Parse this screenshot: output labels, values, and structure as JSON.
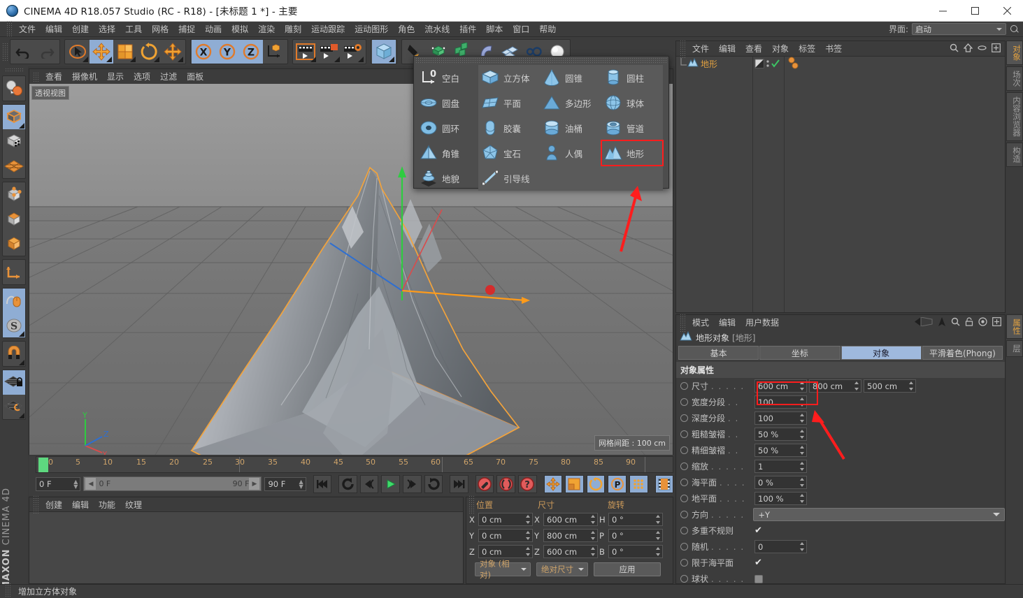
{
  "window": {
    "title": "CINEMA 4D R18.057 Studio (RC - R18) - [未标题 1 *] - 主要",
    "minimize": "—",
    "maximize": "▢",
    "close": "✕"
  },
  "menubar": {
    "items": [
      "文件",
      "编辑",
      "创建",
      "选择",
      "工具",
      "网格",
      "捕捉",
      "动画",
      "模拟",
      "渲染",
      "雕刻",
      "运动跟踪",
      "运动图形",
      "角色",
      "流水线",
      "插件",
      "脚本",
      "窗口",
      "帮助"
    ],
    "interface_label": "界面:",
    "interface_value": "启动"
  },
  "viewport": {
    "menu": [
      "查看",
      "摄像机",
      "显示",
      "选项",
      "过滤",
      "面板"
    ],
    "view_label": "透视视图",
    "grid_info": "网格间距 : 100 cm",
    "axis": {
      "y": "Y",
      "x": "X",
      "z": "Z"
    }
  },
  "primitives_popup": {
    "columns": [
      {
        "shaded": false,
        "items": [
          {
            "label": "空白",
            "icon": "null-object-icon"
          },
          {
            "label": "圆盘",
            "icon": "disc-icon"
          },
          {
            "label": "圆环",
            "icon": "torus-icon"
          },
          {
            "label": "角锥",
            "icon": "pyramid-icon"
          },
          {
            "label": "地貌",
            "icon": "landscape-icon"
          }
        ]
      },
      {
        "shaded": true,
        "items": [
          {
            "label": "立方体",
            "icon": "cube-icon"
          },
          {
            "label": "平面",
            "icon": "plane-icon"
          },
          {
            "label": "胶囊",
            "icon": "capsule-icon"
          },
          {
            "label": "宝石",
            "icon": "platonic-icon"
          },
          {
            "label": "引导线",
            "icon": "guide-line-icon"
          }
        ]
      },
      {
        "shaded": true,
        "items": [
          {
            "label": "圆锥",
            "icon": "cone-icon"
          },
          {
            "label": "多边形",
            "icon": "polygon-icon"
          },
          {
            "label": "油桶",
            "icon": "oil-tank-icon"
          },
          {
            "label": "人偶",
            "icon": "figure-icon"
          }
        ]
      },
      {
        "shaded": true,
        "items": [
          {
            "label": "圆柱",
            "icon": "cylinder-icon"
          },
          {
            "label": "球体",
            "icon": "sphere-icon"
          },
          {
            "label": "管道",
            "icon": "tube-icon"
          },
          {
            "label": "地形",
            "icon": "terrain-icon",
            "highlight": true
          }
        ]
      }
    ]
  },
  "timeline": {
    "ticks": [
      "0",
      "5",
      "10",
      "15",
      "20",
      "25",
      "30",
      "35",
      "40",
      "45",
      "50",
      "55",
      "60",
      "65",
      "70",
      "75",
      "80",
      "85",
      "90"
    ],
    "current_frame": "0 F",
    "range_start": "0 F",
    "range_end": "90 F",
    "end_frame": "90 F",
    "preview_frame": "0 F",
    "buttons": [
      {
        "name": "go-to-start-button",
        "glyph": "◀◀"
      },
      {
        "name": "rewind-button",
        "glyph": "↺"
      },
      {
        "name": "step-back-button",
        "glyph": "◁("
      },
      {
        "name": "play-button",
        "glyph": "▶"
      },
      {
        "name": "step-forward-button",
        "glyph": ")▷"
      },
      {
        "name": "loop-button",
        "glyph": "↻"
      },
      {
        "name": "go-to-end-button",
        "glyph": "▶▶|"
      }
    ]
  },
  "materials": {
    "menu": [
      "创建",
      "编辑",
      "功能",
      "纹理"
    ]
  },
  "coordinates": {
    "headers": [
      "位置",
      "尺寸",
      "旋转"
    ],
    "position": {
      "x": "0 cm",
      "y": "0 cm",
      "z": "0 cm"
    },
    "size": {
      "x": "600 cm",
      "y": "800 cm",
      "z": "600 cm"
    },
    "rotation": {
      "h": "0 °",
      "p": "0 °",
      "b": "0 °"
    },
    "axis_labels": {
      "x": "X",
      "y": "Y",
      "z": "Z",
      "h": "H",
      "p": "P",
      "b": "B"
    },
    "mode_combo": "对象 (相对)",
    "size_combo": "绝对尺寸",
    "apply_button": "应用"
  },
  "object_manager": {
    "menu": [
      "文件",
      "编辑",
      "查看",
      "对象",
      "标签",
      "书签"
    ],
    "rows": [
      {
        "name": "地形",
        "icon": "terrain-icon"
      }
    ]
  },
  "attributes": {
    "menu": [
      "模式",
      "编辑",
      "用户数据"
    ],
    "object_title": "地形对象",
    "object_type": "[地形]",
    "tabs": [
      {
        "label": "基本",
        "active": false
      },
      {
        "label": "坐标",
        "active": false
      },
      {
        "label": "对象",
        "active": true
      },
      {
        "label": "平滑着色(Phong)",
        "active": false
      }
    ],
    "section_title": "对象属性",
    "rows": [
      {
        "label": "尺寸",
        "dots": ". . . . .",
        "type": "triple",
        "values": [
          "600 cm",
          "800 cm",
          "500 cm"
        ],
        "highlight": true
      },
      {
        "label": "宽度分段",
        "dots": ". .",
        "type": "single",
        "values": [
          "100"
        ]
      },
      {
        "label": "深度分段",
        "dots": ". .",
        "type": "single",
        "values": [
          "100"
        ]
      },
      {
        "label": "粗糙皱褶",
        "dots": ". .",
        "type": "single",
        "values": [
          "50 %"
        ]
      },
      {
        "label": "精细皱褶",
        "dots": ". .",
        "type": "single",
        "values": [
          "50 %"
        ]
      },
      {
        "label": "缩放",
        "dots": ". . . . .",
        "type": "single",
        "values": [
          "1"
        ]
      },
      {
        "label": "海平面",
        "dots": ". . . .",
        "type": "single",
        "values": [
          "0 %"
        ]
      },
      {
        "label": "地平面",
        "dots": ". . . .",
        "type": "single",
        "values": [
          "100 %"
        ]
      },
      {
        "label": "方向",
        "dots": ". . . . .",
        "type": "combo",
        "values": [
          "+Y"
        ]
      },
      {
        "label": "多重不规则",
        "dots": "",
        "type": "checked",
        "values": [
          "✔"
        ]
      },
      {
        "label": "随机",
        "dots": ". . . . .",
        "type": "single",
        "values": [
          "0"
        ]
      },
      {
        "label": "限于海平面",
        "dots": "",
        "type": "checked",
        "values": [
          "✔"
        ]
      },
      {
        "label": "球状",
        "dots": ". . . . .",
        "type": "unchecked",
        "values": [
          ""
        ]
      }
    ]
  },
  "right_tabs_top": [
    {
      "label": "对象",
      "active": true
    },
    {
      "label": "场次",
      "active": false
    },
    {
      "label": "内容浏览器",
      "active": false
    },
    {
      "label": "构造",
      "active": false
    }
  ],
  "right_tabs_bottom": [
    {
      "label": "属性",
      "active": true
    },
    {
      "label": "层",
      "active": false
    }
  ],
  "statusbar": {
    "message": "增加立方体对象"
  },
  "branding": {
    "maxon": "MAXON",
    "product": "CINEMA 4D"
  },
  "colors": {
    "accent_orange": "#e0a040",
    "highlight_red": "#ff1d1d",
    "tab_active_blue": "#9fb9dd",
    "panel_bg": "#3c3c3c",
    "field_bg": "#333333"
  }
}
